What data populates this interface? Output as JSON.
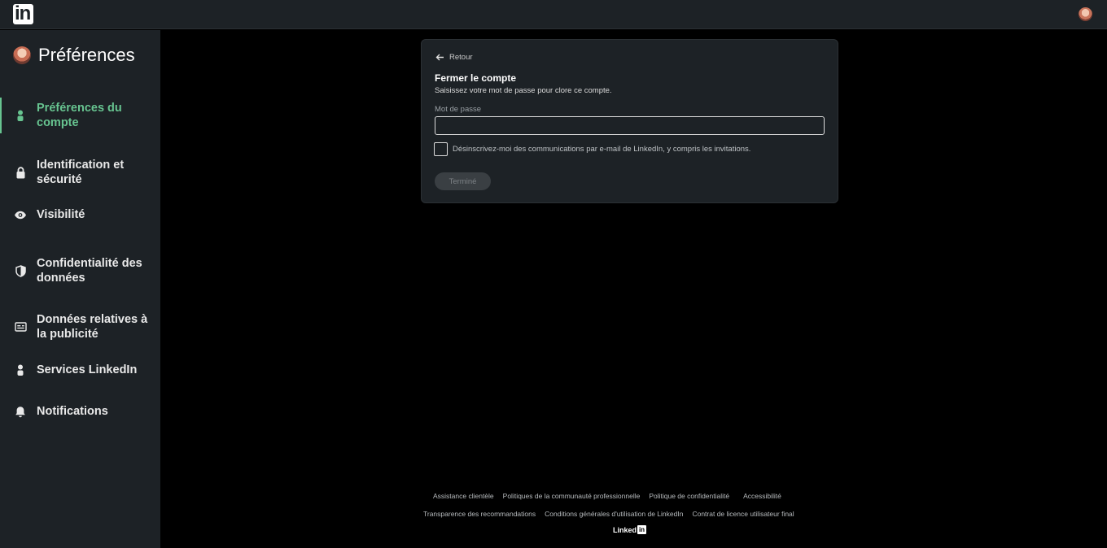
{
  "topbar": {
    "logo_text": "in",
    "logo_icon": "linkedin-logo-icon",
    "avatar_icon": "user-avatar-icon"
  },
  "sidebar": {
    "title": "Préférences",
    "items": [
      {
        "label": "Préférences du compte",
        "icon": "person-icon",
        "active": true
      },
      {
        "label": "Identification et sécurité",
        "icon": "lock-icon",
        "active": false
      },
      {
        "label": "Visibilité",
        "icon": "eye-icon",
        "active": false
      },
      {
        "label": "Confidentialité des données",
        "icon": "shield-icon",
        "active": false
      },
      {
        "label": "Données relatives à la publicité",
        "icon": "ad-card-icon",
        "active": false
      },
      {
        "label": "Services LinkedIn",
        "icon": "person-icon",
        "active": false
      },
      {
        "label": "Notifications",
        "icon": "bell-icon",
        "active": false
      }
    ]
  },
  "card": {
    "back_label": "Retour",
    "title": "Fermer le compte",
    "subtitle": "Saisissez votre mot de passe pour clore ce compte.",
    "password_label": "Mot de passe",
    "password_value": "",
    "unsubscribe_label": "Désinscrivez-moi des communications par e-mail de LinkedIn, y compris les invitations.",
    "unsubscribe_checked": false,
    "done_label": "Terminé"
  },
  "footer": {
    "row1": [
      "Assistance clientèle",
      "Politiques de la communauté professionnelle",
      "Politique de confidentialité",
      "Accessibilité"
    ],
    "row2": [
      "Transparence des recommandations",
      "Conditions générales d'utilisation de LinkedIn",
      "Contrat de licence utilisateur final"
    ],
    "brand_text": "Linked",
    "brand_badge": "in"
  },
  "colors": {
    "accent": "#67c490",
    "panel": "#1d2226",
    "background": "#000000"
  }
}
